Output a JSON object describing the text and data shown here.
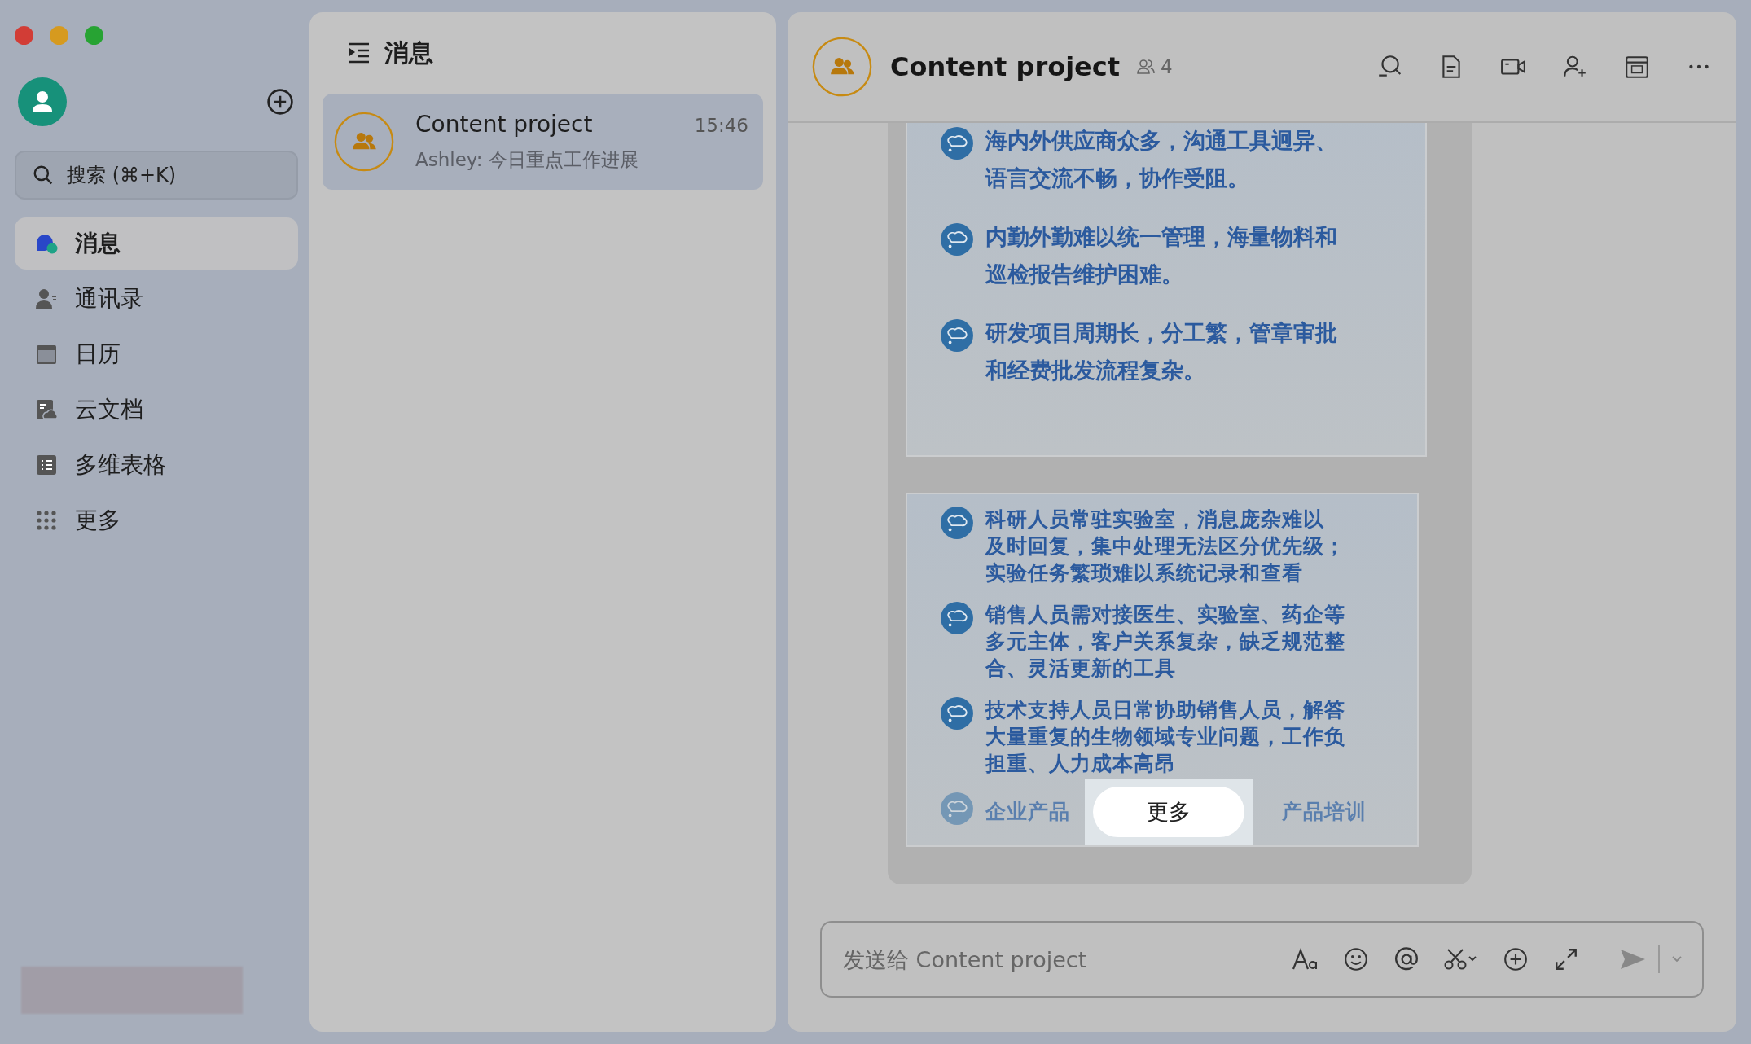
{
  "sidebar": {
    "search": {
      "placeholder": "搜索 (⌘+K)"
    },
    "nav": [
      {
        "label": "消息",
        "selected": true
      },
      {
        "label": "通讯录",
        "selected": false
      },
      {
        "label": "日历",
        "selected": false
      },
      {
        "label": "云文档",
        "selected": false
      },
      {
        "label": "多维表格",
        "selected": false
      },
      {
        "label": "更多",
        "selected": false
      }
    ]
  },
  "list": {
    "title": "消息",
    "conversations": [
      {
        "name": "Content project",
        "time": "15:46",
        "preview": "Ashley: 今日重点工作进展",
        "selected": true
      }
    ]
  },
  "chat": {
    "title": "Content project",
    "member_count": "4",
    "slides": [
      {
        "bullets": [
          {
            "lines": [
              "海内外供应商众多，沟通工具迥异、",
              "语言交流不畅，协作受阻。"
            ]
          },
          {
            "lines": [
              "内勤外勤难以统一管理，海量物料和",
              "巡检报告维护困难。"
            ]
          },
          {
            "lines": [
              "研发项目周期长，分工繁，管章审批",
              "和经费批发流程复杂。"
            ]
          }
        ]
      },
      {
        "bullets": [
          {
            "lines": [
              "科研人员常驻实验室，消息庞杂难以",
              "及时回复，集中处理无法区分优先级；",
              "实验任务繁琐难以系统记录和查看"
            ]
          },
          {
            "lines": [
              "销售人员需对接医生、实验室、药企等",
              "多元主体，客户关系复杂，缺乏规范整",
              "合、灵活更新的工具"
            ]
          },
          {
            "lines": [
              "技术支持人员日常协助销售人员，解答",
              "大量重复的生物领域专业问题，工作负",
              "担重、人力成本高昂"
            ]
          },
          {
            "kind": "faded",
            "lines": [
              "企业产品",
              "产品培训"
            ]
          }
        ]
      }
    ],
    "more_button": "更多",
    "composer": {
      "placeholder": "发送给 Content project"
    }
  }
}
